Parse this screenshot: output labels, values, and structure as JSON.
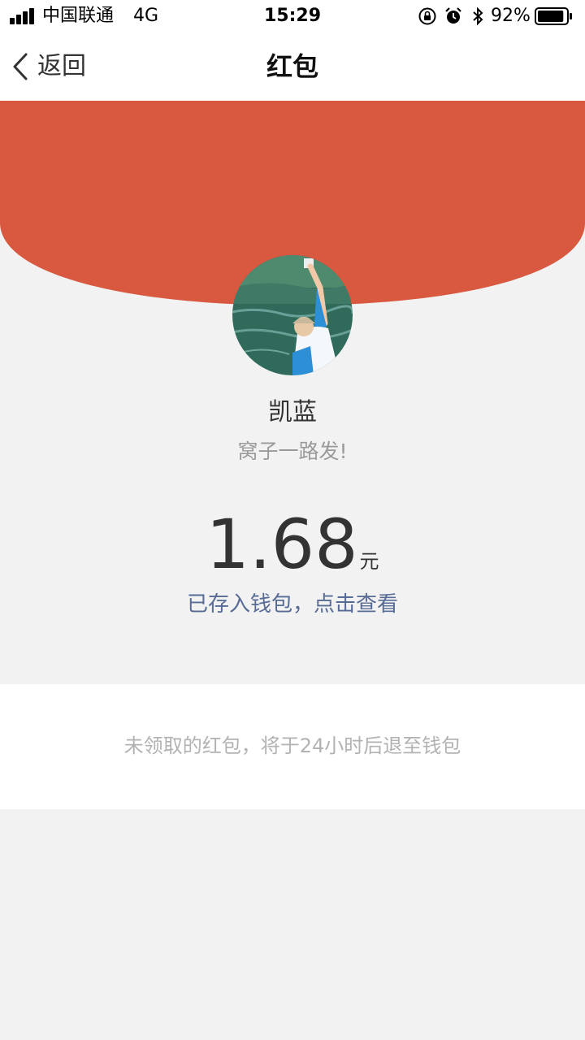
{
  "status_bar": {
    "carrier": "中国联通",
    "network": "4G",
    "time": "15:29",
    "battery_percent": "92%",
    "battery_level": 0.92,
    "icons": [
      "signal-icon",
      "orientation-lock-icon",
      "alarm-icon",
      "bluetooth-icon",
      "battery-icon"
    ]
  },
  "nav": {
    "back_label": "返回",
    "title": "红包"
  },
  "envelope": {
    "sender_name": "凯蓝",
    "greeting": "窝子一路发!",
    "amount": "1.68",
    "unit": "元",
    "wallet_link": "已存入钱包，点击查看"
  },
  "notice": {
    "text": "未领取的红包，将于24小时后退至钱包"
  },
  "colors": {
    "header_red": "#d95940",
    "link_blue": "#576b95",
    "background": "#f2f2f2"
  }
}
